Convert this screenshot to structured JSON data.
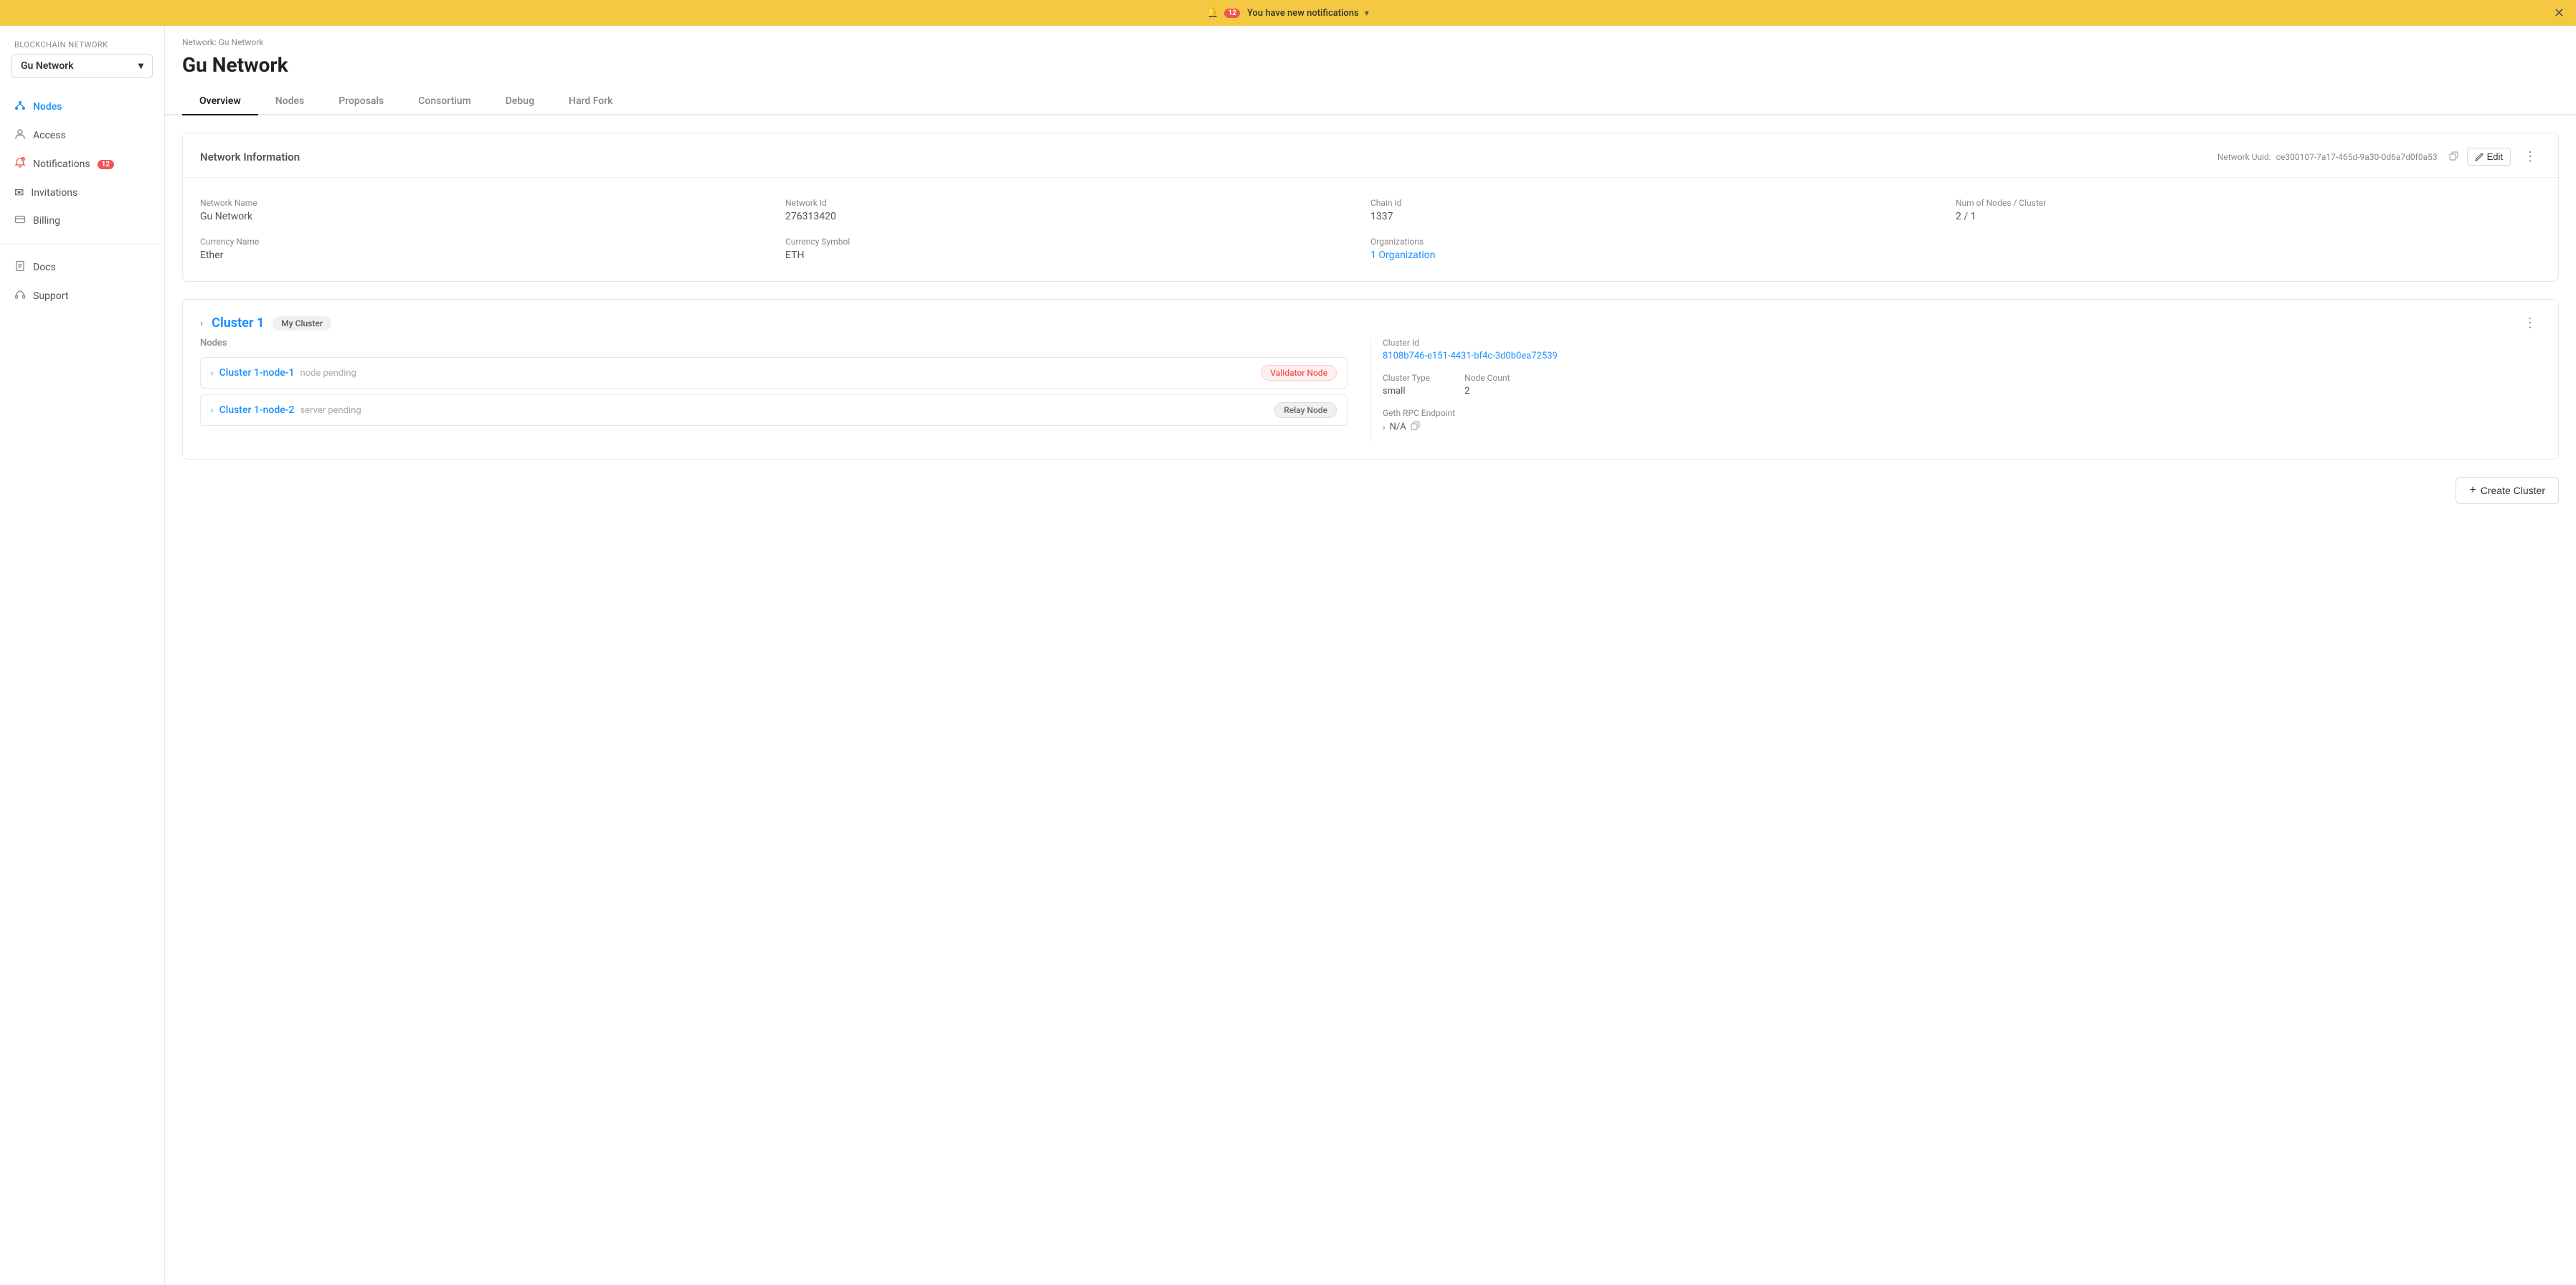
{
  "banner": {
    "badge_count": "12",
    "message": "You have new notifications",
    "chevron": "▾"
  },
  "sidebar": {
    "section_label": "Blockchain Network",
    "network_selector": "Gu Network",
    "nav_items": [
      {
        "id": "nodes",
        "label": "Nodes",
        "icon": "⬡",
        "active": true,
        "badge": null
      },
      {
        "id": "access",
        "label": "Access",
        "icon": "👤",
        "active": false,
        "badge": null
      },
      {
        "id": "notifications",
        "label": "Notifications",
        "icon": "🔔",
        "active": false,
        "badge": "12"
      },
      {
        "id": "invitations",
        "label": "Invitations",
        "icon": "✉",
        "active": false,
        "badge": null
      },
      {
        "id": "billing",
        "label": "Billing",
        "icon": "💳",
        "active": false,
        "badge": null
      },
      {
        "id": "docs",
        "label": "Docs",
        "icon": "📄",
        "active": false,
        "badge": null
      },
      {
        "id": "support",
        "label": "Support",
        "icon": "💬",
        "active": false,
        "badge": null
      }
    ]
  },
  "breadcrumb": "Network: Gu Network",
  "page_title": "Gu Network",
  "tabs": [
    {
      "id": "overview",
      "label": "Overview",
      "active": true
    },
    {
      "id": "nodes",
      "label": "Nodes",
      "active": false
    },
    {
      "id": "proposals",
      "label": "Proposals",
      "active": false
    },
    {
      "id": "consortium",
      "label": "Consortium",
      "active": false
    },
    {
      "id": "debug",
      "label": "Debug",
      "active": false
    },
    {
      "id": "hardfork",
      "label": "Hard Fork",
      "active": false
    }
  ],
  "network_info": {
    "card_title": "Network Information",
    "uuid_label": "Network Uuid:",
    "uuid_value": "ce300107-7a17-465d-9a30-0d6a7d0f0a53",
    "edit_label": "Edit",
    "network_name_label": "Network Name",
    "network_name_value": "Gu Network",
    "currency_name_label": "Currency Name",
    "currency_name_value": "Ether",
    "currency_symbol_label": "Currency Symbol",
    "currency_symbol_value": "ETH",
    "network_id_label": "Network Id",
    "network_id_value": "276313420",
    "chain_id_label": "Chain Id",
    "chain_id_value": "1337",
    "num_nodes_label": "Num of Nodes / Cluster",
    "num_nodes_value": "2 / 1",
    "organizations_label": "Organizations",
    "organizations_value": "1 Organization"
  },
  "cluster": {
    "title": "Cluster 1",
    "badge": "My Cluster",
    "nodes_label": "Nodes",
    "nodes": [
      {
        "name": "Cluster 1-node-1",
        "status": "node pending",
        "type": "Validator Node",
        "type_class": "validator"
      },
      {
        "name": "Cluster 1-node-2",
        "status": "server pending",
        "type": "Relay Node",
        "type_class": "relay"
      }
    ],
    "cluster_id_label": "Cluster Id",
    "cluster_id_value": "8108b746-e151-4431-bf4c-3d0b0ea72539",
    "cluster_type_label": "Cluster Type",
    "cluster_type_value": "small",
    "node_count_label": "Node Count",
    "node_count_value": "2",
    "geth_rpc_label": "Geth RPC Endpoint",
    "geth_rpc_value": "N/A"
  },
  "create_cluster_btn": "+ Create Cluster"
}
